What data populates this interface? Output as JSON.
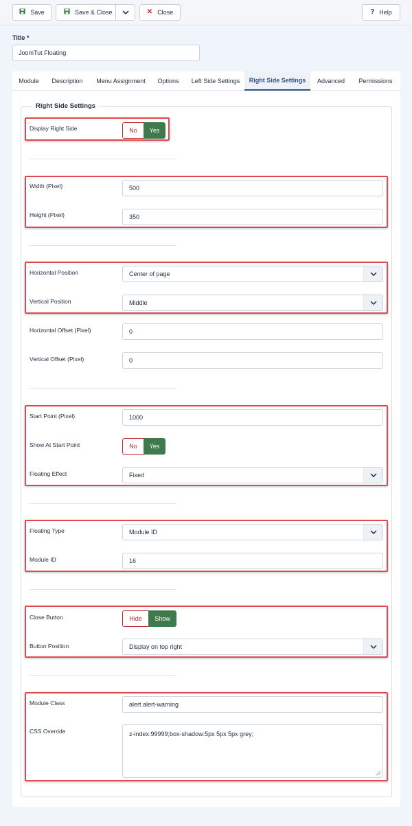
{
  "toolbar": {
    "save_label": "Save",
    "save_close_label": "Save & Close",
    "close_label": "Close",
    "help_label": "Help"
  },
  "title": {
    "label": "Title *",
    "value": "JoomTut Floating"
  },
  "tabs": [
    {
      "label": "Module"
    },
    {
      "label": "Description"
    },
    {
      "label": "Menu Assignment"
    },
    {
      "label": "Options"
    },
    {
      "label": "Left Side Settings"
    },
    {
      "label": "Right Side Settings",
      "active": true
    },
    {
      "label": "Advanced"
    },
    {
      "label": "Permissions"
    }
  ],
  "fieldset": {
    "legend": "Right Side Settings"
  },
  "fields": {
    "display_right_side": {
      "label": "Display Right Side",
      "off": "No",
      "on": "Yes",
      "value": "Yes"
    },
    "width": {
      "label": "Width (Pixel)",
      "value": "500"
    },
    "height": {
      "label": "Height (Pixel)",
      "value": "350"
    },
    "horizontal_position": {
      "label": "Horizontal Position",
      "value": "Center of page"
    },
    "vertical_position": {
      "label": "Vertical Position",
      "value": "Middle"
    },
    "horizontal_offset": {
      "label": "Horizontal Offset (Pixel)",
      "value": "0"
    },
    "vertical_offset": {
      "label": "Vertical Offset (Pixel)",
      "value": "0"
    },
    "start_point": {
      "label": "Start Point (Pixel)",
      "value": "1000"
    },
    "show_at_start_point": {
      "label": "Show At Start Point",
      "off": "No",
      "on": "Yes",
      "value": "Yes"
    },
    "floating_effect": {
      "label": "Floating Effect",
      "value": "Fixed"
    },
    "floating_type": {
      "label": "Floating Type",
      "value": "Module ID"
    },
    "module_id": {
      "label": "Module ID",
      "value": "16"
    },
    "close_button": {
      "label": "Close Button",
      "off": "Hide",
      "on": "Show",
      "value": "Show"
    },
    "button_position": {
      "label": "Button Position",
      "value": "Display on top right"
    },
    "module_class": {
      "label": "Module Class",
      "value": "alert alert-warning"
    },
    "css_override": {
      "label": "CSS Override",
      "value": "z-index:99999;box-shadow:5px 5px 5px grey;"
    }
  },
  "colors": {
    "accent": "#2a4f8a",
    "toggle_on": "#3f7a4d",
    "toggle_off_text": "#c0262e",
    "highlight": "#e0474e"
  }
}
